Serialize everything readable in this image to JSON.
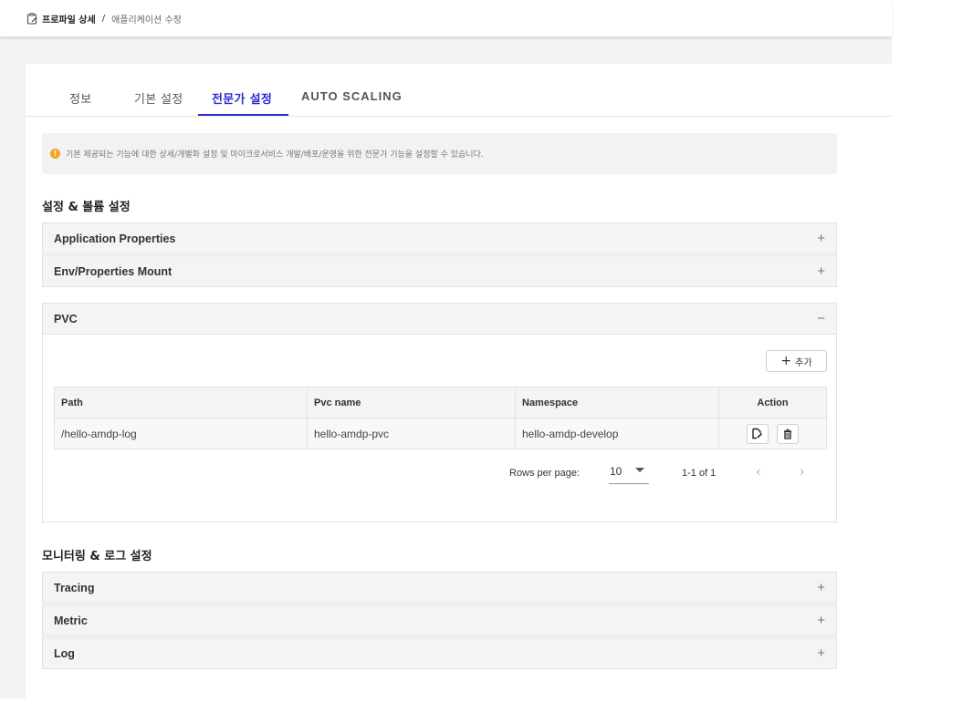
{
  "breadcrumb": {
    "icon": "clipboard-edit-icon",
    "root": "프로파일 상세",
    "separator": "/",
    "current": "애플리케이션 수정"
  },
  "tabs": [
    {
      "label": "정보",
      "active": false
    },
    {
      "label": "기본 설정",
      "active": false
    },
    {
      "label": "전문가 설정",
      "active": true
    },
    {
      "label": "AUTO SCALING",
      "active": false
    }
  ],
  "notice": {
    "icon": "info-icon",
    "text": "기본 제공되는 기능에 대한 상세/개별화 설정 및 마이크로서비스 개발/배포/운영을 위한 전문가 기능을 설정할 수 있습니다."
  },
  "sections": {
    "settings_title": "설정 & 볼륨 설정",
    "monitoring_title": "모니터링 & 로그 설정"
  },
  "accordions": {
    "app_props": {
      "label": "Application Properties",
      "toggle": "+"
    },
    "env_mount": {
      "label": "Env/Properties Mount",
      "toggle": "+"
    },
    "pvc": {
      "label": "PVC",
      "toggle": "−"
    },
    "tracing": {
      "label": "Tracing",
      "toggle": "+"
    },
    "metric": {
      "label": "Metric",
      "toggle": "+"
    },
    "log": {
      "label": "Log",
      "toggle": "+"
    }
  },
  "pvc_table": {
    "add_label": "추가",
    "headers": {
      "path": "Path",
      "pvc_name": "Pvc name",
      "namespace": "Namespace",
      "action": "Action"
    },
    "rows": [
      {
        "path": "/hello-amdp-log",
        "pvc_name": "hello-amdp-pvc",
        "namespace": "hello-amdp-develop"
      }
    ]
  },
  "pagination": {
    "rows_per_page_label": "Rows per page:",
    "rows_per_page": "10",
    "range": "1-1 of 1",
    "prev": "‹",
    "next": "›"
  },
  "colors": {
    "accent": "#2b2bd0",
    "info": "#f5a623",
    "background": "#f3f3f3"
  }
}
